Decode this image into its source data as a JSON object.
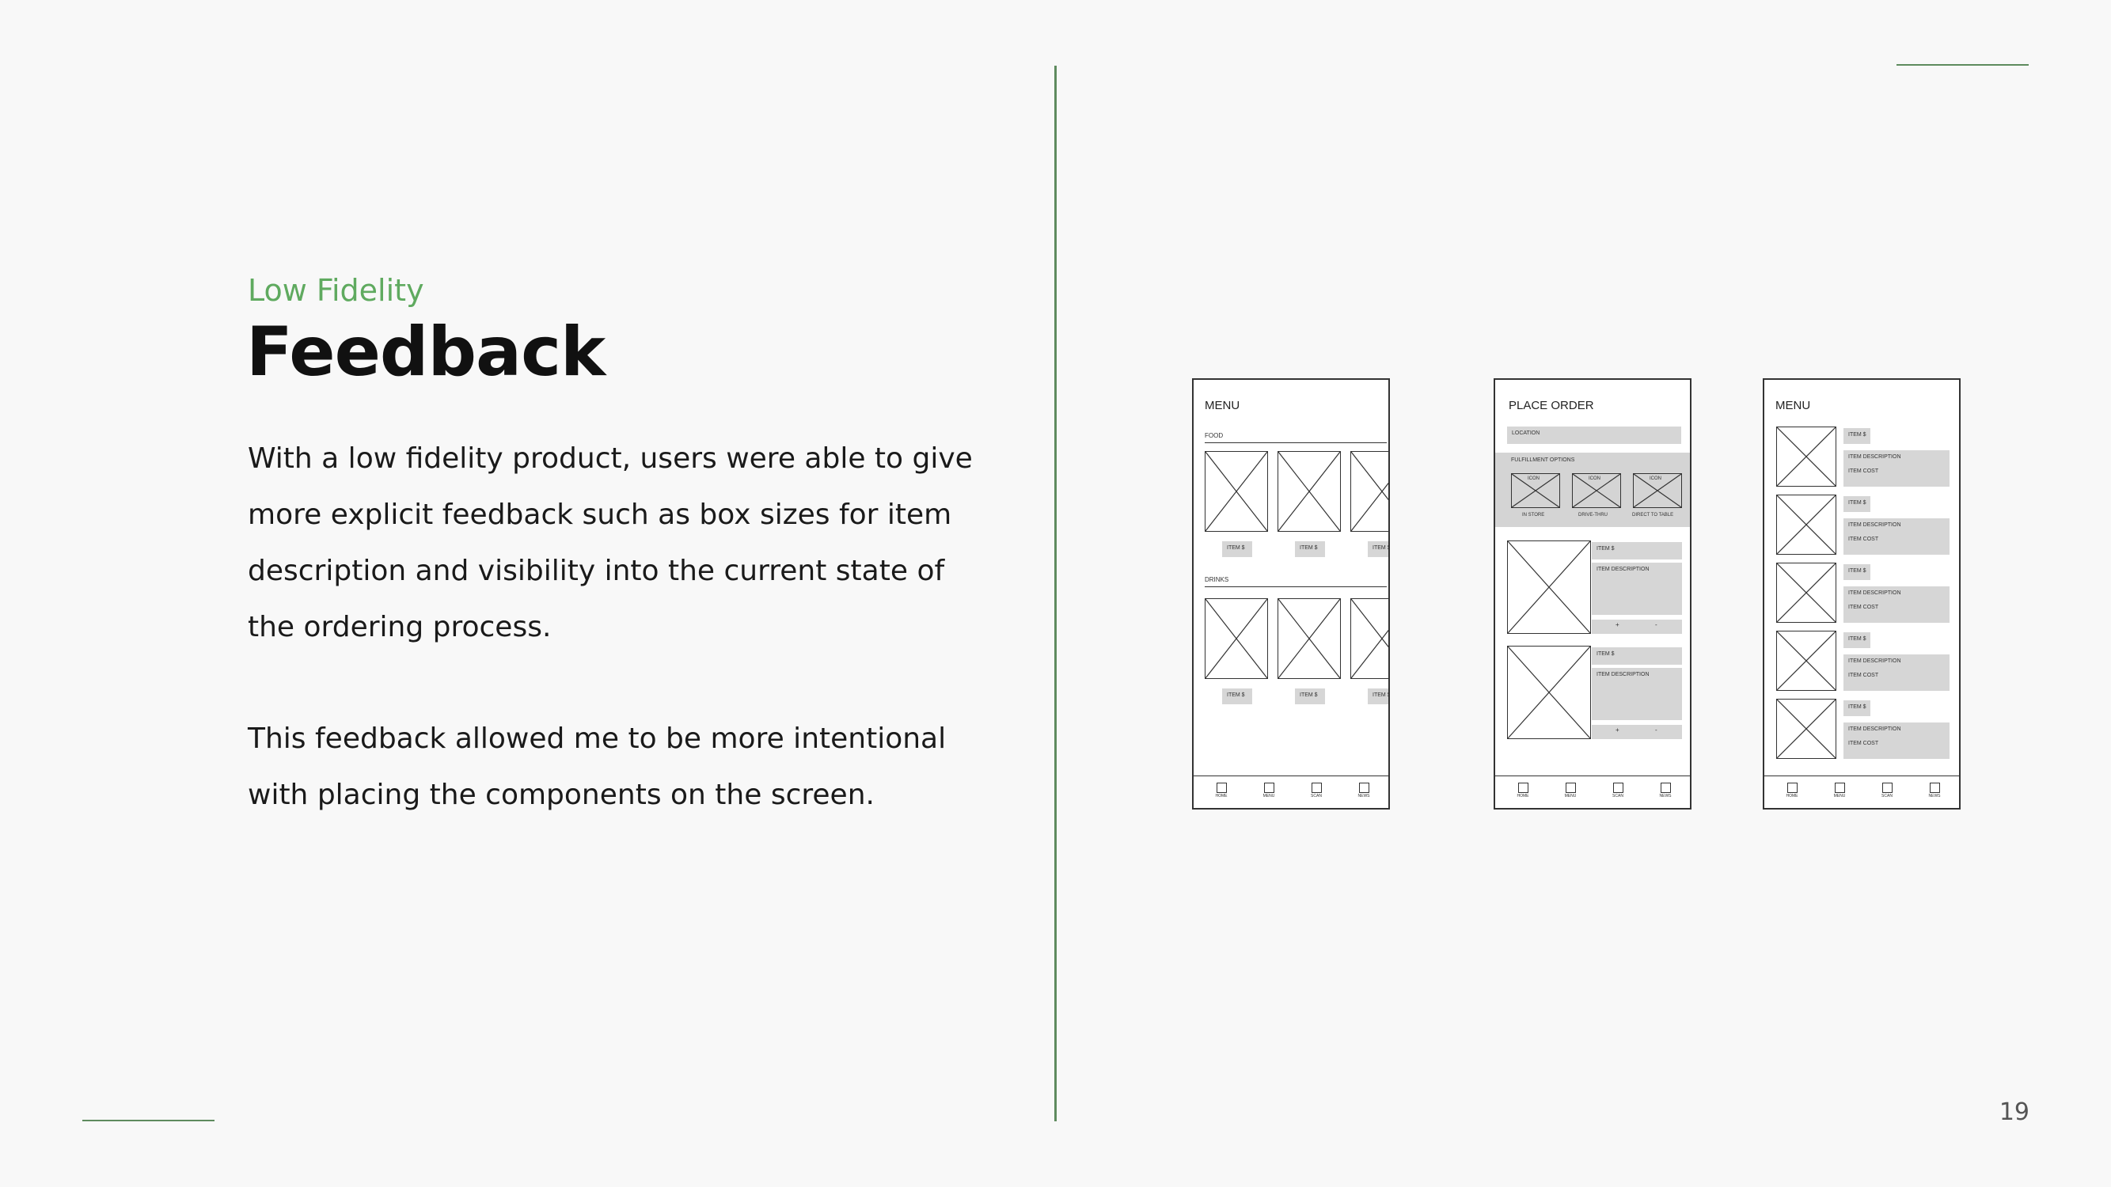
{
  "slide": {
    "subtitle": "Low Fidelity",
    "title": "Feedback",
    "paragraph_1": "With a low fidelity product, users were able to give more explicit feedback such as box sizes for item description and visibility into the current state of the ordering process.",
    "paragraph_2": "This feedback allowed me to be more intentional with placing the components on the screen.",
    "page_number": "19",
    "accent_color": "#5e8b5e",
    "subtitle_color": "#5faa5f"
  },
  "wireframes": {
    "nav": [
      "HOME",
      "MENU",
      "SCAN",
      "NEWS"
    ],
    "menu_grid": {
      "title": "MENU",
      "section_food": "FOOD",
      "section_drinks": "DRINKS",
      "item_label": "ITEM $"
    },
    "place_order": {
      "title": "PLACE ORDER",
      "location": "LOCATION",
      "fulfillment": "FULFILLMENT OPTIONS",
      "icon_label": "ICON",
      "options": [
        "IN STORE",
        "DRIVE-THRU",
        "DIRECT TO TABLE"
      ],
      "item1": "ITEM $",
      "item2": "ITEM $",
      "description": "ITEM DESCRIPTION",
      "plus": "+",
      "minus": "-"
    },
    "menu_list": {
      "title": "MENU",
      "item_label": "ITEM $",
      "description": "ITEM DESCRIPTION",
      "cost": "ITEM COST"
    }
  }
}
